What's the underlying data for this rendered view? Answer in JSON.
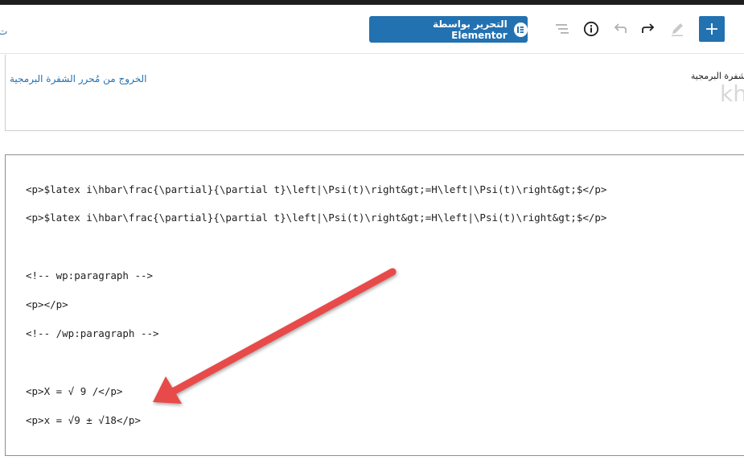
{
  "toolbar": {
    "edge_char": "ت",
    "elementor_label": "التحرير بواسطة Elementor"
  },
  "header": {
    "exit_code_editor": "الخروج من مُحرر الشفرة البرمجية",
    "code_editor_label": "شفرة البرمجية",
    "logo_fragment": "kh"
  },
  "code": {
    "lines": [
      "<p>$latex i\\hbar\\frac{\\partial}{\\partial t}\\left|\\Psi(t)\\right&gt;=H\\left|\\Psi(t)\\right&gt;$</p>",
      "<p>$latex i\\hbar\\frac{\\partial}{\\partial t}\\left|\\Psi(t)\\right&gt;=H\\left|\\Psi(t)\\right&gt;$</p>",
      "<!-- wp:paragraph -->",
      "<p></p>",
      "<!-- /wp:paragraph -->",
      "<p>X = √ 9 /</p>",
      "<p>x = √9 ± √18</p>"
    ]
  },
  "annotation": {
    "arrow_color": "#e84a4a"
  }
}
